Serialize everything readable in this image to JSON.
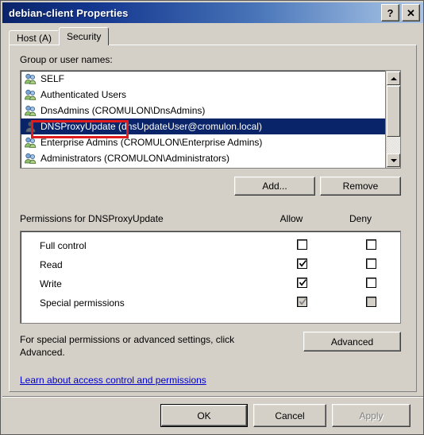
{
  "window": {
    "title": "debian-client Properties",
    "help_button": "?",
    "close_button": "✕"
  },
  "tabs": [
    {
      "label": "Host (A)",
      "active": false
    },
    {
      "label": "Security",
      "active": true
    }
  ],
  "security": {
    "group_list_label": "Group or user names:",
    "entries": [
      {
        "name": "SELF",
        "icon": "group-icon",
        "selected": false
      },
      {
        "name": "Authenticated Users",
        "icon": "group-icon",
        "selected": false
      },
      {
        "name": "DnsAdmins (CROMULON\\DnsAdmins)",
        "icon": "group-icon",
        "selected": false
      },
      {
        "name": "DNSProxyUpdate (dnsUpdateUser@cromulon.local)",
        "icon": "user-icon",
        "selected": true
      },
      {
        "name": "Enterprise Admins (CROMULON\\Enterprise Admins)",
        "icon": "group-icon",
        "selected": false
      },
      {
        "name": "Administrators (CROMULON\\Administrators)",
        "icon": "group-icon",
        "selected": false
      }
    ],
    "add_button": "Add...",
    "remove_button": "Remove",
    "permissions_label": "Permissions for DNSProxyUpdate",
    "allow_column": "Allow",
    "deny_column": "Deny",
    "permissions": [
      {
        "name": "Full control",
        "allow": false,
        "deny": false,
        "disabled": false
      },
      {
        "name": "Read",
        "allow": true,
        "deny": false,
        "disabled": false
      },
      {
        "name": "Write",
        "allow": true,
        "deny": false,
        "disabled": false
      },
      {
        "name": "Special permissions",
        "allow": true,
        "deny": false,
        "disabled": true
      }
    ],
    "advanced_note_line1": "For special permissions or advanced settings, click",
    "advanced_note_line2": "Advanced.",
    "advanced_button": "Advanced",
    "learn_link": "Learn about access control and permissions"
  },
  "footer": {
    "ok_button": "OK",
    "cancel_button": "Cancel",
    "apply_button": "Apply"
  },
  "annotation": {
    "highlight_target": "DNSProxyUpdate",
    "color": "#e01b1b"
  },
  "colors": {
    "title_gradient_start": "#0a246a",
    "title_gradient_end": "#a8c3e4",
    "dialog_face": "#d4d0c8",
    "selection": "#0a246a",
    "link": "#0000c8"
  }
}
